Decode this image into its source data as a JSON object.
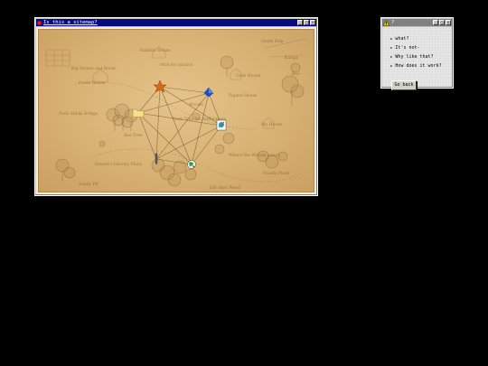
{
  "map_window": {
    "title": "Is this a sitemap?",
    "controls": [
      "_",
      "□",
      "×"
    ]
  },
  "map": {
    "sketch_labels": [
      "Pooh Sticks Bridge",
      "Poohs House",
      "Owls House",
      "My House",
      "Rabbits House",
      "Kanga",
      "Eeyore's Gloomy Place",
      "Woozle",
      "100 Aker Wood",
      "Where the Woozle wasnt",
      "Bee Tree",
      "Piglets House",
      "Big Stones and Rocks",
      "Pooh Trap for Heffalumps",
      "Sandy Pit",
      "Nice for picnics",
      "Floody Place",
      "North Pole",
      "Roo"
    ],
    "nodes": [
      {
        "id": "star",
        "icon": "star-icon",
        "color": "#d86a10"
      },
      {
        "id": "drive",
        "icon": "blue-gem-icon",
        "color": "#2050c8"
      },
      {
        "id": "folder",
        "icon": "folder-icon",
        "color": "#f0dc8c"
      },
      {
        "id": "palette",
        "icon": "paint-palette-icon",
        "color": "#3a8ad8"
      },
      {
        "id": "pen",
        "icon": "pencil-icon",
        "color": "#606060"
      },
      {
        "id": "globe",
        "icon": "globe-icon",
        "color": "#3a9a3a"
      }
    ]
  },
  "help_window": {
    "title": "?",
    "controls": [
      "_",
      "□",
      "×"
    ],
    "items": [
      "what?",
      "It's not-",
      "Why like that?",
      "How does it work?"
    ],
    "go_back": "Go back"
  }
}
